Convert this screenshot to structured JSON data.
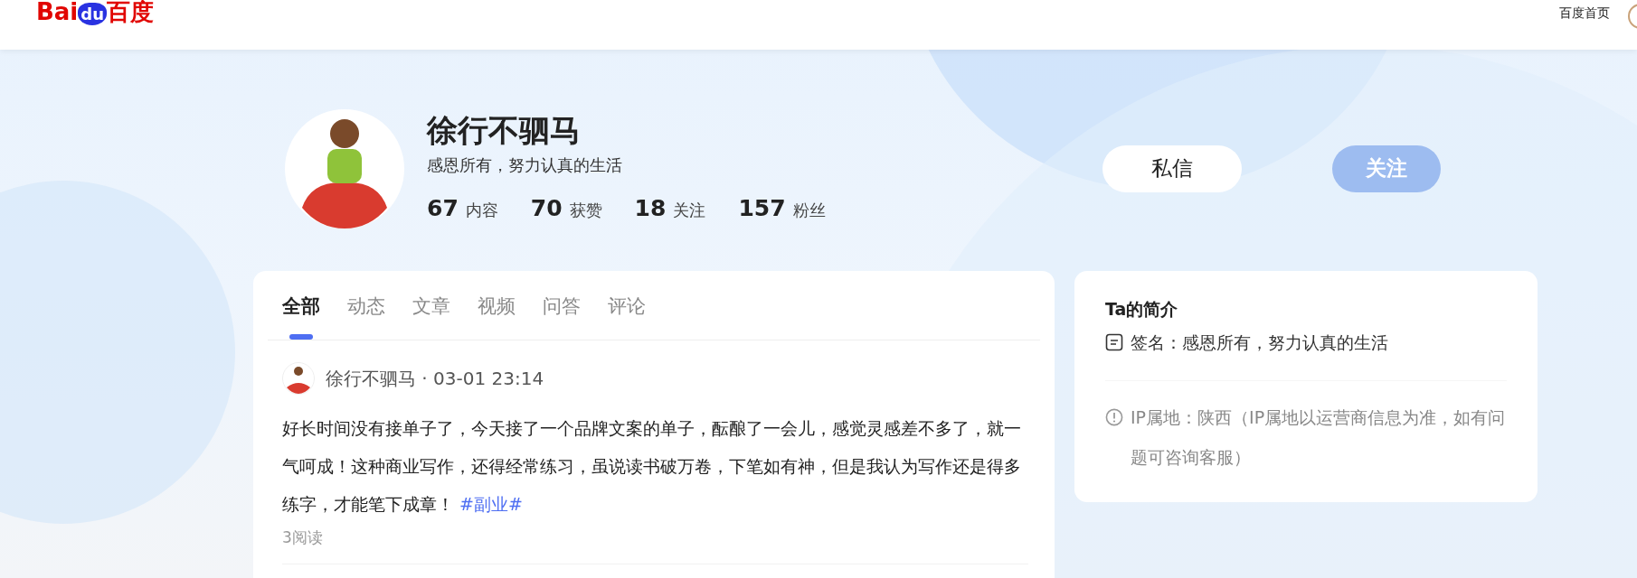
{
  "header": {
    "logo": [
      "Bai",
      "du",
      "百度"
    ],
    "home_link": "百度首页"
  },
  "profile": {
    "name": "徐行不驷马",
    "bio": "感恩所有，努力认真的生活",
    "stats": [
      {
        "value": "67",
        "label": "内容"
      },
      {
        "value": "70",
        "label": "获赞"
      },
      {
        "value": "18",
        "label": "关注"
      },
      {
        "value": "157",
        "label": "粉丝"
      }
    ],
    "buttons": [
      {
        "label": "私信",
        "kind": "pill"
      },
      {
        "label": "关注",
        "kind": "ghost"
      }
    ]
  },
  "tabs": [
    {
      "label": "全部",
      "selected": true
    },
    {
      "label": "动态",
      "selected": false
    },
    {
      "label": "文章",
      "selected": false
    },
    {
      "label": "视频",
      "selected": false
    },
    {
      "label": "问答",
      "selected": false
    },
    {
      "label": "评论",
      "selected": false
    }
  ],
  "posts": [
    {
      "byline": "徐行不驷马 · 03-01 23:14",
      "text": "好长时间没有接单子了，今天接了一个品牌文案的单子，酝酿了一会儿，感觉灵感差不多了，就一气呵成！这种商业写作，还得经常练习，虽说读书破万卷，下笔如有神，但是我认为写作还是得多练字，才能笔下成章！",
      "tag": "#副业#",
      "reads": "3阅读"
    }
  ],
  "intro": {
    "title": "Ta的简介",
    "signature": "签名：感恩所有，努力认真的生活",
    "ip": "IP属地：陕西（IP属地以运营商信息为准，如有问题可咨询客服）"
  }
}
